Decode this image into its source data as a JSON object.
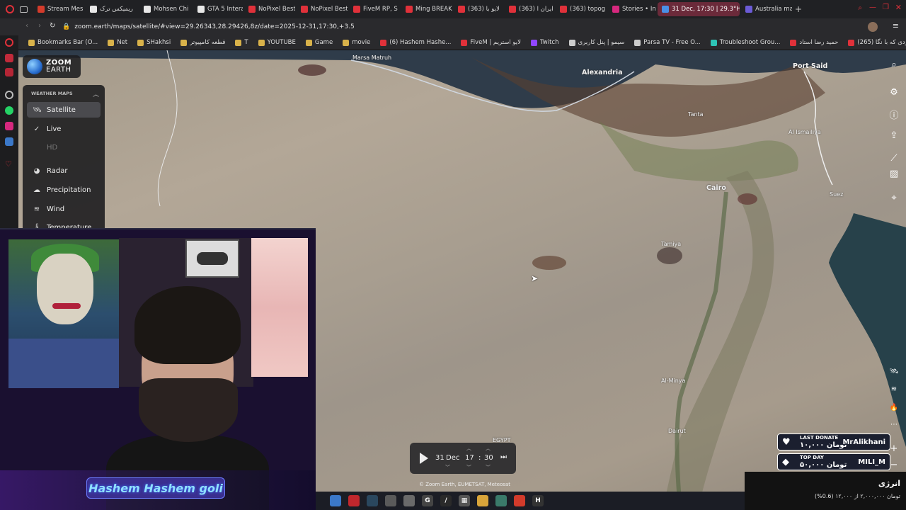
{
  "browser": {
    "tabs": [
      {
        "label": "Stream Mes",
        "color": "#d33b2b"
      },
      {
        "label": "ریمیکس ترک",
        "color": "#e8e8e8"
      },
      {
        "label": "Mohsen Chi",
        "color": "#e8e8e8"
      },
      {
        "label": "GTA 5 Intera",
        "color": "#e8e8e8"
      },
      {
        "label": "NoPixel Best",
        "color": "#e0313a"
      },
      {
        "label": "NoPixel Best",
        "color": "#e0313a"
      },
      {
        "label": "FiveM RP, S",
        "color": "#e0313a"
      },
      {
        "label": "Ming BREAK",
        "color": "#e0313a"
      },
      {
        "label": "(363) لایو با",
        "color": "#e0313a"
      },
      {
        "label": "(363) ایران ا",
        "color": "#e0313a"
      },
      {
        "label": "(363) topog",
        "color": "#e0313a"
      },
      {
        "label": "Stories • Ins",
        "color": "#d6287e"
      },
      {
        "label": "31 Dec, 17:30 | 29.3°H",
        "color": "#4a8fe6",
        "active": true
      },
      {
        "label": "Australia ma",
        "color": "#6b5bd6"
      }
    ],
    "url": "zoom.earth/maps/satellite/#view=29.26343,28.29426,8z/date=2025-12-31,17:30,+3.5",
    "bookmarks": [
      {
        "label": "Bookmarks Bar (O...",
        "color": "#d9b24a"
      },
      {
        "label": "Net",
        "color": "#d9b24a"
      },
      {
        "label": "SHakhsi",
        "color": "#d9b24a"
      },
      {
        "label": "قطعه کامپیوتر",
        "color": "#d9b24a"
      },
      {
        "label": "T",
        "color": "#d9b24a"
      },
      {
        "label": "YOUTUBE",
        "color": "#d9b24a"
      },
      {
        "label": "Game",
        "color": "#d9b24a"
      },
      {
        "label": "movie",
        "color": "#d9b24a"
      },
      {
        "label": "(6) Hashem Hashe...",
        "color": "#e0313a"
      },
      {
        "label": "FiveM | لایو استریم",
        "color": "#e0313a"
      },
      {
        "label": "Twitch",
        "color": "#9146ff"
      },
      {
        "label": "سیمو | پنل کاربری",
        "color": "#cccccc"
      },
      {
        "label": "Parsa TV - Free O...",
        "color": "#cccccc"
      },
      {
        "label": "Troubleshoot Grou...",
        "color": "#2ec4b6"
      },
      {
        "label": "حمید رضا استاد",
        "color": "#e0313a"
      },
      {
        "label": "(265) مردی که با نگا...",
        "color": "#e0313a"
      }
    ]
  },
  "map": {
    "brand": {
      "line1": "ZOOM",
      "line2": "EARTH"
    },
    "panel_title": "WEATHER MAPS",
    "layers": [
      {
        "label": "Satellite",
        "icon": "satellite-icon",
        "glyph": "🛰",
        "selected": true
      },
      {
        "label": "Live",
        "icon": "check-icon",
        "glyph": "✓"
      },
      {
        "label": "HD",
        "icon": "none",
        "glyph": "",
        "dim": true
      },
      {
        "label": "Radar",
        "icon": "radar-icon",
        "glyph": "◕"
      },
      {
        "label": "Precipitation",
        "icon": "cloud-icon",
        "glyph": "☁"
      },
      {
        "label": "Wind",
        "icon": "wind-icon",
        "glyph": "≋"
      },
      {
        "label": "Temperature",
        "icon": "thermometer-icon",
        "glyph": "🌡"
      }
    ],
    "cities": [
      {
        "name": "Marsa Matruh",
        "big": false
      },
      {
        "name": "Alexandria",
        "big": true
      },
      {
        "name": "Port Said",
        "big": true
      },
      {
        "name": "Tanta",
        "big": false
      },
      {
        "name": "Al Ismailiya",
        "big": false
      },
      {
        "name": "Cairo",
        "big": true
      },
      {
        "name": "Suez",
        "big": false
      },
      {
        "name": "Tamiya",
        "big": false
      },
      {
        "name": "Al-Minya",
        "big": false
      },
      {
        "name": "Dairut",
        "big": false
      },
      {
        "name": "EGYPT",
        "big": false
      }
    ],
    "time": {
      "day": "31",
      "month": "Dec",
      "hour": "17",
      "sep": ":",
      "minute": "30"
    },
    "copyright": "© Zoom Earth, EUMETSAT, Meteosat"
  },
  "stream": {
    "nameplate": "Hashem Hashem goli",
    "last_donate": {
      "label": "LAST DONATE",
      "amount": "۱۰,۰۰۰ تومان",
      "user": "MrAlikhani"
    },
    "top_day": {
      "label": "TOP DAY",
      "amount": "۵۰,۰۰۰ تومان",
      "user": "MILI_M"
    },
    "goal": {
      "title": "انرژی",
      "subtitle": "(%0.6) تومان ۲,۰۰۰,۰۰۰ از ۱۲,۰۰۰"
    }
  },
  "taskbar": [
    {
      "name": "file-explorer-icon",
      "color": "#3b78c9",
      "glyph": ""
    },
    {
      "name": "opera-icon",
      "color": "#c1272d",
      "glyph": ""
    },
    {
      "name": "steam-icon",
      "color": "#2a475e",
      "glyph": ""
    },
    {
      "name": "app-icon",
      "color": "#5a5a5a",
      "glyph": ""
    },
    {
      "name": "shield-icon",
      "color": "#6a6a6a",
      "glyph": ""
    },
    {
      "name": "g-app-icon",
      "color": "#444",
      "glyph": "G"
    },
    {
      "name": "pen-icon",
      "color": "#2a2a2a",
      "glyph": "/"
    },
    {
      "name": "calculator-icon",
      "color": "#555",
      "glyph": "▦"
    },
    {
      "name": "folder-icon",
      "color": "#d9a53a",
      "glyph": ""
    },
    {
      "name": "box-icon",
      "color": "#3a7a6a",
      "glyph": ""
    },
    {
      "name": "chrome-icon",
      "color": "#d23b2b",
      "glyph": ""
    },
    {
      "name": "h-app-icon",
      "color": "#333",
      "glyph": "H"
    }
  ]
}
